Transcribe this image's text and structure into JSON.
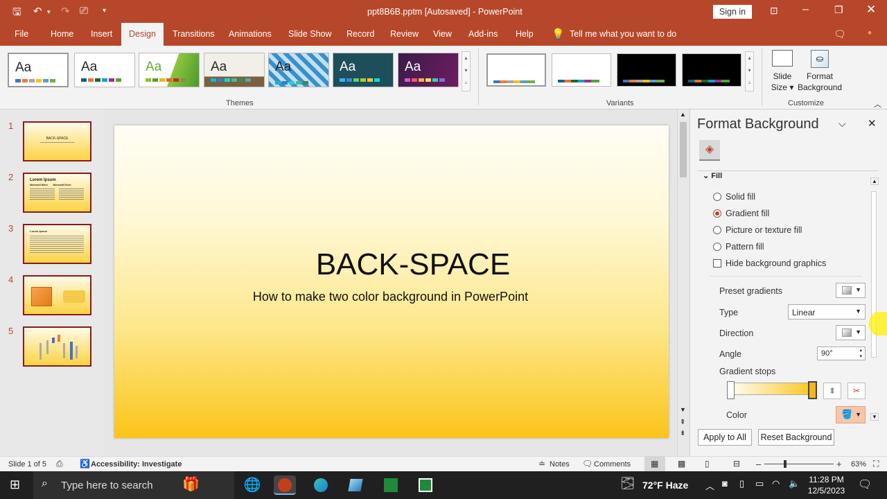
{
  "title": {
    "text": "ppt8B6B.pptm [Autosaved] - PowerPoint",
    "signin": "Sign in"
  },
  "tabs": [
    "File",
    "Home",
    "Insert",
    "Design",
    "Transitions",
    "Animations",
    "Slide Show",
    "Record",
    "Review",
    "View",
    "Add-ins",
    "Help"
  ],
  "tell_me": "Tell me what you want to do",
  "ribbon": {
    "theme_sample": "Aa",
    "themes_label": "Themes",
    "variants_label": "Variants",
    "customize_label": "Customize",
    "slide_size": [
      "Slide",
      "Size"
    ],
    "format_background": [
      "Format",
      "Background"
    ]
  },
  "thumbnails": {
    "numbers": [
      "1",
      "2",
      "3",
      "4",
      "5"
    ],
    "slide1_title": "BACK-SPACE",
    "slide2_title": "Lorem Ipsum",
    "slide2_col1": "Microsoft Word",
    "slide2_col2": "Microsoft Excel",
    "slide3_title": "Lorem Ipsum"
  },
  "slide": {
    "title": "BACK-SPACE",
    "subtitle": "How to make two color background in PowerPoint"
  },
  "pane": {
    "title": "Format Background",
    "fill_header": "Fill",
    "options": [
      "Solid fill",
      "Gradient fill",
      "Picture or texture fill",
      "Pattern fill"
    ],
    "selected_option": "Gradient fill",
    "hide_bg": "Hide background graphics",
    "preset_label": "Preset gradients",
    "type_label": "Type",
    "type_value": "Linear",
    "direction_label": "Direction",
    "angle_label": "Angle",
    "angle_value": "90°",
    "stops_label": "Gradient stops",
    "color_label": "Color",
    "apply_all": "Apply to All",
    "reset": "Reset Background"
  },
  "status": {
    "slide": "Slide 1 of 5",
    "accessibility": "Accessibility: Investigate",
    "notes": "Notes",
    "comments": "Comments",
    "zoom": "63%"
  },
  "taskbar": {
    "search_placeholder": "Type here to search",
    "weather": "72°F  Haze",
    "time": "11:28 PM",
    "date": "12/5/2023"
  },
  "colors": {
    "accent": "#b7472a",
    "gradient_top": "#fffdf5",
    "gradient_bottom": "#fcc419"
  }
}
